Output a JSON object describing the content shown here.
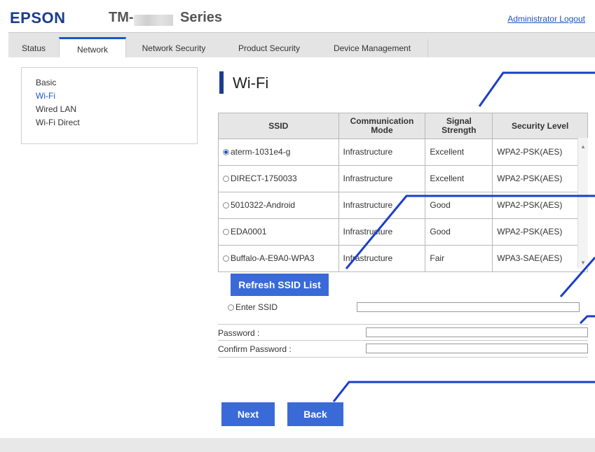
{
  "header": {
    "logo": "EPSON",
    "model_prefix": "TM-",
    "model_suffix": "Series",
    "logout_label": "Administrator Logout"
  },
  "tabs": [
    {
      "label": "Status",
      "active": false
    },
    {
      "label": "Network",
      "active": true
    },
    {
      "label": "Network Security",
      "active": false
    },
    {
      "label": "Product Security",
      "active": false
    },
    {
      "label": "Device Management",
      "active": false
    }
  ],
  "sidebar": {
    "items": [
      {
        "label": "Basic",
        "active": false
      },
      {
        "label": "Wi-Fi",
        "active": true
      },
      {
        "label": "Wired LAN",
        "active": false
      },
      {
        "label": "Wi-Fi Direct",
        "active": false
      }
    ]
  },
  "page_title": "Wi-Fi",
  "table": {
    "headers": [
      "SSID",
      "Communication Mode",
      "Signal Strength",
      "Security Level"
    ],
    "rows": [
      {
        "ssid": "aterm-1031e4-g",
        "mode": "Infrastructure",
        "signal": "Excellent",
        "security": "WPA2-PSK(AES)",
        "selected": true
      },
      {
        "ssid": "DIRECT-1750033",
        "mode": "Infrastructure",
        "signal": "Excellent",
        "security": "WPA2-PSK(AES)",
        "selected": false
      },
      {
        "ssid": "5010322-Android",
        "mode": "Infrastructure",
        "signal": "Good",
        "security": "WPA2-PSK(AES)",
        "selected": false
      },
      {
        "ssid": "EDA0001",
        "mode": "Infrastructure",
        "signal": "Good",
        "security": "WPA2-PSK(AES)",
        "selected": false
      },
      {
        "ssid": "Buffalo-A-E9A0-WPA3",
        "mode": "Infrastructure",
        "signal": "Fair",
        "security": "WPA3-SAE(AES)",
        "selected": false
      }
    ]
  },
  "refresh_button": "Refresh SSID List",
  "enter_ssid_label": "Enter SSID",
  "enter_ssid_value": "",
  "password_label": "Password :",
  "password_value": "",
  "confirm_password_label": "Confirm Password :",
  "confirm_password_value": "",
  "next_button": "Next",
  "back_button": "Back",
  "colors": {
    "accent": "#3a6ad8",
    "brand": "#1a3e8c",
    "callout": "#1a3ec8"
  }
}
